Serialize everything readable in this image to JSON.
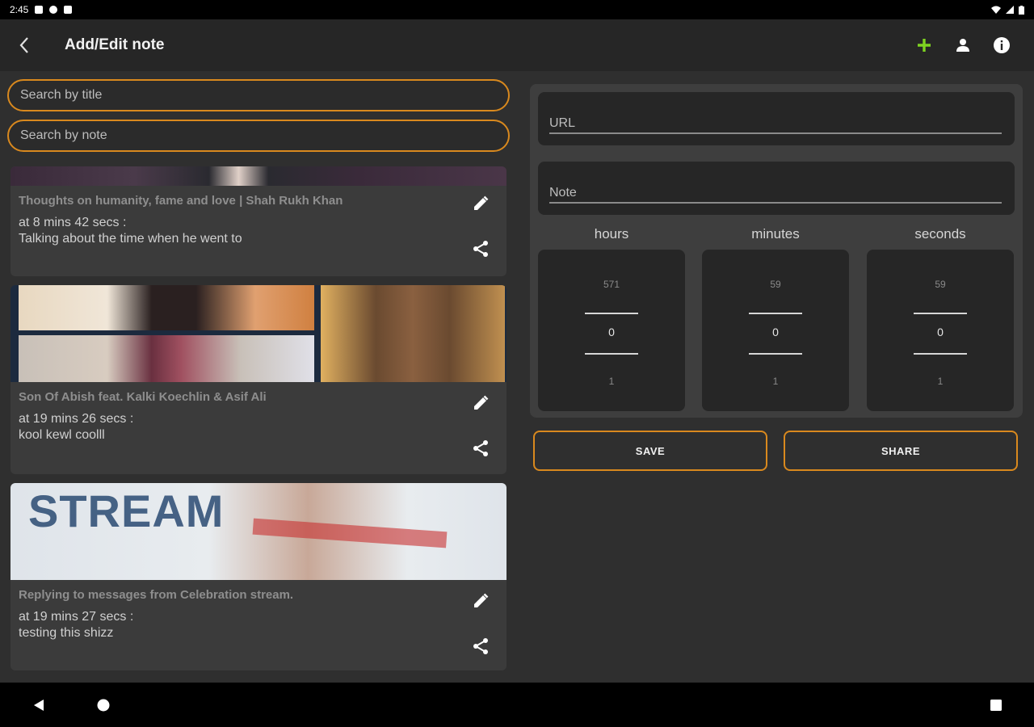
{
  "status_bar": {
    "time": "2:45"
  },
  "app_bar": {
    "title": "Add/Edit note"
  },
  "search": {
    "title_placeholder": "Search by title",
    "note_placeholder": "Search by note"
  },
  "notes": [
    {
      "title": "Thoughts on humanity, fame and love | Shah Rukh Khan",
      "time": "at 8 mins 42 secs :",
      "note": "Talking about the time when he went to"
    },
    {
      "title": "Son Of Abish feat. Kalki Koechlin & Asif Ali",
      "time": "at 19 mins 26 secs :",
      "note": "kool kewl coolll"
    },
    {
      "title": "Replying to messages from Celebration stream.",
      "time": "at 19 mins 27 secs :",
      "note": "testing this shizz",
      "thumb_text": "STREAM"
    }
  ],
  "form": {
    "url_placeholder": "URL",
    "note_placeholder": "Note",
    "pickers": [
      {
        "label": "hours",
        "prev": "571",
        "value": "0",
        "next": "1"
      },
      {
        "label": "minutes",
        "prev": "59",
        "value": "0",
        "next": "1"
      },
      {
        "label": "seconds",
        "prev": "59",
        "value": "0",
        "next": "1"
      }
    ],
    "save_label": "SAVE",
    "share_label": "SHARE"
  },
  "colors": {
    "accent": "#d9891e",
    "add_icon": "#7ed321",
    "background": "#2f2f2f",
    "card": "#3b3b3b"
  },
  "icons": [
    "back-arrow-icon",
    "add-icon",
    "person-icon",
    "info-icon",
    "edit-icon",
    "share-icon"
  ]
}
